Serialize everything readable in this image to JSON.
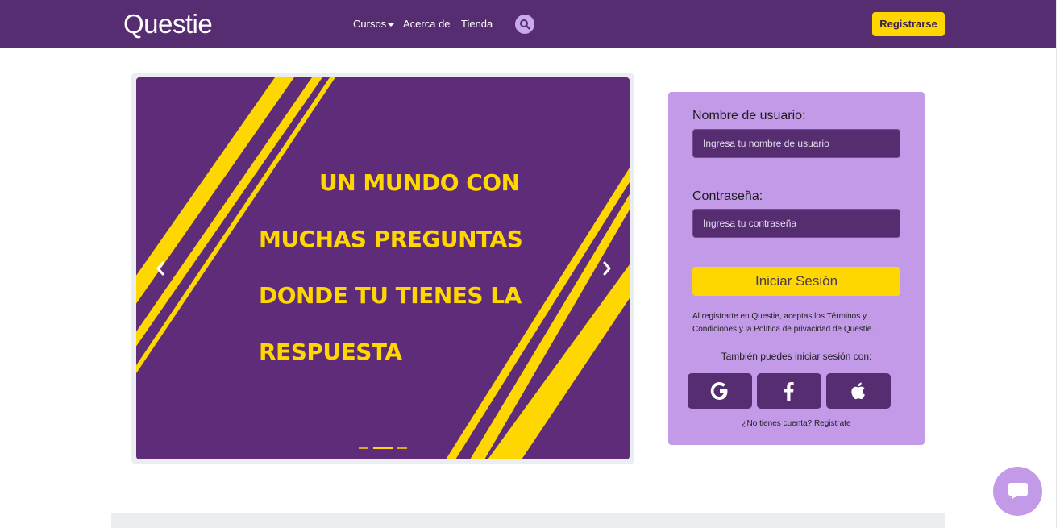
{
  "navbar": {
    "logo": "Questie",
    "links": [
      "Cursos",
      "Acerca de",
      "Tienda"
    ],
    "register_label": "Registrarse",
    "search_icon": "search-icon"
  },
  "carousel": {
    "lines": [
      "UN MUNDO CON",
      "MUCHAS PREGUNTAS",
      "DONDE TU TIENES LA",
      "RESPUESTA"
    ],
    "slides_count": 3,
    "active_slide": 2,
    "prev_icon": "chevron-left-icon",
    "next_icon": "chevron-right-icon",
    "colors": {
      "background": "#5e2c78",
      "accent": "#ffd700"
    }
  },
  "login": {
    "username_label": "Nombre de usuario:",
    "username_placeholder": "Ingresa tu nombre de usuario",
    "password_label": "Contraseña:",
    "password_placeholder": "Ingresa tu contraseña",
    "submit_label": "Iniciar Sesión",
    "terms_text": "Al registrarte en Questie, aceptas los Términos y Condiciones y la Política de privacidad de Questie.",
    "also_label": "También puedes iniciar sesión con:",
    "social": [
      "google-icon",
      "facebook-icon",
      "apple-icon"
    ],
    "signup_text": "¿No tienes cuenta? Registrate"
  },
  "chat": {
    "icon": "chat-icon"
  },
  "colors": {
    "primary": "#552d70",
    "panel": "#c39ae8",
    "accent": "#ffd700"
  }
}
